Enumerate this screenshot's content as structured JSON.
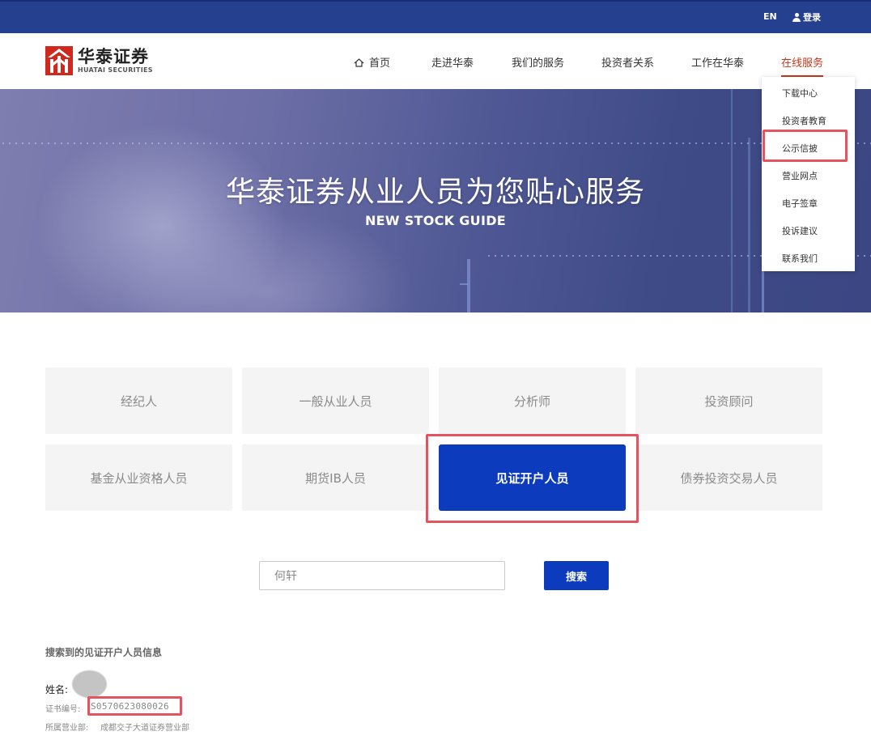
{
  "topbar": {
    "lang": "EN",
    "login": "登录"
  },
  "brand": {
    "name_cn": "华泰证券",
    "name_en": "HUATAI SECURITIES",
    "color": "#d0281c"
  },
  "nav": {
    "items": [
      {
        "label": "首页",
        "icon": "home-icon"
      },
      {
        "label": "走进华泰"
      },
      {
        "label": "我们的服务"
      },
      {
        "label": "投资者关系"
      },
      {
        "label": "工作在华泰"
      },
      {
        "label": "在线服务",
        "active": true
      }
    ]
  },
  "dropdown": {
    "items": [
      "下载中心",
      "投资者教育",
      "公示信披",
      "营业网点",
      "电子签章",
      "投诉建议",
      "联系我们"
    ],
    "highlighted": "公示信披"
  },
  "banner": {
    "title": "华泰证券从业人员为您贴心服务",
    "subtitle": "NEW STOCK GUIDE"
  },
  "categories": [
    {
      "label": "经纪人"
    },
    {
      "label": "一般从业人员"
    },
    {
      "label": "分析师"
    },
    {
      "label": "投资顾问"
    },
    {
      "label": "基金从业资格人员"
    },
    {
      "label": "期货IB人员"
    },
    {
      "label": "见证开户人员",
      "active": true
    },
    {
      "label": "债券投资交易人员"
    }
  ],
  "search": {
    "value": "何轩",
    "button": "搜索"
  },
  "result": {
    "title": "搜索到的见证开户人员信息",
    "name_label": "姓名:",
    "cert_label": "证书编号:",
    "cert_value": "S0570623080026",
    "branch_label": "所属营业部:",
    "branch_value": "成都交子大道证券营业部"
  },
  "colors": {
    "topbar": "#25408f",
    "accent": "#0c3cbd",
    "active_nav": "#c8371b",
    "highlight": "#e25560"
  }
}
